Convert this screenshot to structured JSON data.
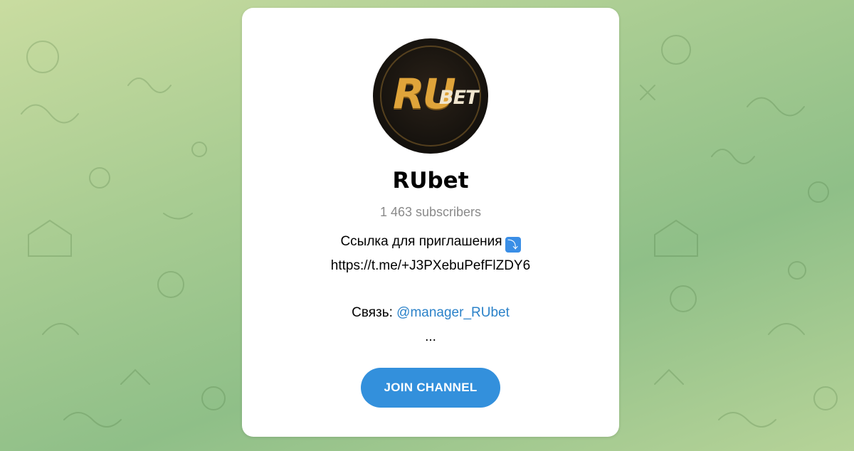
{
  "channel": {
    "name": "RUbet",
    "subscribers": "1 463 subscribers",
    "avatar": {
      "logo_main": "RU",
      "logo_sub": "BET"
    }
  },
  "description": {
    "line1_text": "Ссылка для приглашения",
    "line1_emoji": "⤵",
    "line2": "https://t.me/+J3PXebuPefFlZDY6",
    "line3_prefix": "Связь: ",
    "line3_link": "@manager_RUbet",
    "line4": "..."
  },
  "actions": {
    "join_label": "JOIN CHANNEL"
  },
  "colors": {
    "accent": "#3390dc",
    "link": "#2b82c9",
    "subtle_text": "#8a8a8a"
  }
}
